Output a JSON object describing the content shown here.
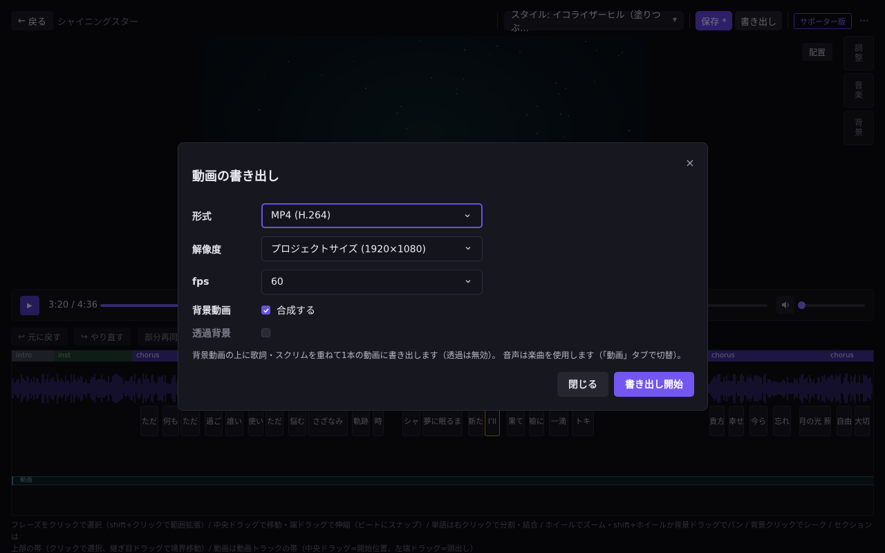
{
  "header": {
    "back_label": "戻る",
    "project_name": "シャイニングスター",
    "style_select": "スタイル: イコライザーヒル（塗りつぶ…",
    "save_label": "保存 *",
    "export_label": "書き出し",
    "supporter_label": "サポーター版",
    "more_label": "⋯"
  },
  "preview": {
    "layout_label": "配置",
    "side_tabs": [
      "調整",
      "音楽",
      "背景"
    ]
  },
  "transport": {
    "time": "3:20 / 4:36",
    "progress": 0.725,
    "volume": 0.0
  },
  "edit_toolbar": {
    "undo_label": "元に戻す",
    "redo_label": "やり直す",
    "partial_label": "部分再同"
  },
  "timeline": {
    "sections": [
      {
        "name": "intro",
        "color": "#3a3a48"
      },
      {
        "name": "inst",
        "color": "#1f3a2e"
      },
      {
        "name": "chorus",
        "color": "#3a2d8a"
      },
      {
        "name": "chorus",
        "color": "#3a2d8a"
      },
      {
        "name": "chorus",
        "color": "#3a2d8a"
      }
    ],
    "phrases": [
      "ただ",
      "何も",
      "ただ",
      "過ご",
      "誰い",
      "使い",
      "ただ",
      "悩む",
      "さざなみ",
      "軌跡",
      "時",
      "シャ",
      "夢に眠るま",
      "新た",
      "I'll",
      "果て",
      "瞼に",
      "一滴",
      "トキ",
      "貴方",
      "幸せ",
      "今ら",
      "忘れ",
      "月の光",
      "照",
      "自由",
      "大切"
    ],
    "video_track_label": "動画"
  },
  "help_text": [
    "フレーズをクリックで選択（shift+クリックで範囲拡張）/ 中央ドラッグで移動・端ドラッグで伸縮（ビートにスナップ）/ 単語は右クリックで分割・結合 / ホイールでズーム・shift+ホイールか背景ドラッグでパン / 背景クリックでシーク / セクションは",
    "上部の帯（クリックで選択、継ぎ目ドラッグで境界移動）/ 動画は動画トラックの帯（中央ドラッグ=開始位置、左端ドラッグ=頭出し）"
  ],
  "modal": {
    "title": "動画の書き出し",
    "close_icon": "×",
    "format": {
      "label": "形式",
      "value": "MP4 (H.264)"
    },
    "resolution": {
      "label": "解像度",
      "value": "プロジェクトサイズ (1920×1080)"
    },
    "fps": {
      "label": "fps",
      "value": "60"
    },
    "bg_video": {
      "label": "背景動画",
      "checked": true,
      "text": "合成する"
    },
    "transparent": {
      "label": "透過背景",
      "checked": false
    },
    "note": "背景動画の上に歌詞・スクリムを重ねて1本の動画に書き出します（透過は無効）。 音声は楽曲を使用します（「動画」タブで切替）。",
    "close_button": "閉じる",
    "start_button": "書き出し開始"
  },
  "colors": {
    "accent": "#6a52e0",
    "accent_strong": "#7457f0",
    "background": "#0b0b11"
  }
}
